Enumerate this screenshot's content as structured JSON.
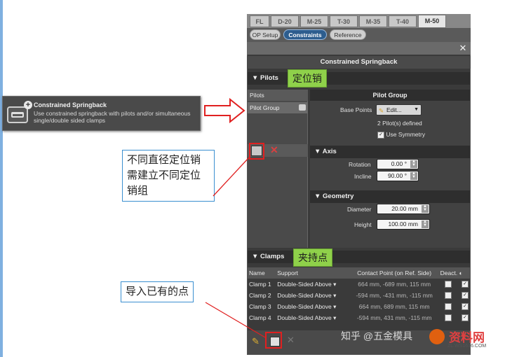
{
  "tooltip": {
    "title": "Constrained Springback",
    "desc": "Use constrained springback with pilots and/or simultaneous single/double sided clamps"
  },
  "tabs": [
    "FL",
    "D-20",
    "M-25",
    "T-30",
    "M-35",
    "T-40",
    "M-50"
  ],
  "active_tab": "M-50",
  "subtabs": [
    "OP Setup",
    "Constraints",
    "Reference"
  ],
  "active_subtab": "Constraints",
  "panel_title": "Constrained Springback",
  "pilots": {
    "header": "Pilots",
    "annotation": "定位销",
    "list_header": "Pilots",
    "items": [
      "Pilot Group"
    ],
    "group_title": "Pilot Group",
    "base_points_label": "Base Points",
    "edit_label": "Edit...",
    "defined_text": "2 Pilot(s) defined",
    "use_symmetry_label": "Use Symmetry"
  },
  "axis": {
    "header": "Axis",
    "rotation_label": "Rotation",
    "rotation_value": "0.00 °",
    "incline_label": "Incline",
    "incline_value": "90.00 °"
  },
  "geometry": {
    "header": "Geometry",
    "diameter_label": "Diameter",
    "diameter_value": "20.00 mm",
    "height_label": "Height",
    "height_value": "100.00 mm"
  },
  "clamps": {
    "header": "Clamps",
    "annotation": "夹持点",
    "columns": [
      "Name",
      "Support",
      "Contact Point (on Ref. Side)",
      "Deact."
    ],
    "rows": [
      {
        "name": "Clamp 1",
        "support": "Double-Sided Above",
        "point": "664 mm, -689 mm, 115 mm"
      },
      {
        "name": "Clamp 2",
        "support": "Double-Sided Above",
        "point": "-594 mm, -431 mm, -115 mm"
      },
      {
        "name": "Clamp 3",
        "support": "Double-Sided Above",
        "point": "664 mm, 689 mm, 115 mm"
      },
      {
        "name": "Clamp 4",
        "support": "Double-Sided Above",
        "point": "-594 mm, 431 mm, -115 mm"
      }
    ]
  },
  "callouts": {
    "pilot_group_note": "不同直径定位销需建立不同定位销组",
    "import_note": "导入已有的点"
  },
  "watermark": {
    "text1": "知乎 @五金模具",
    "logo": "资料网",
    "url": "ZL.WS1616.COM"
  },
  "colors": {
    "annotation_green": "#8fd14a",
    "highlight_red": "#e02020",
    "callout_border": "#3a8fd0",
    "active_pill": "#2d5d8e"
  }
}
